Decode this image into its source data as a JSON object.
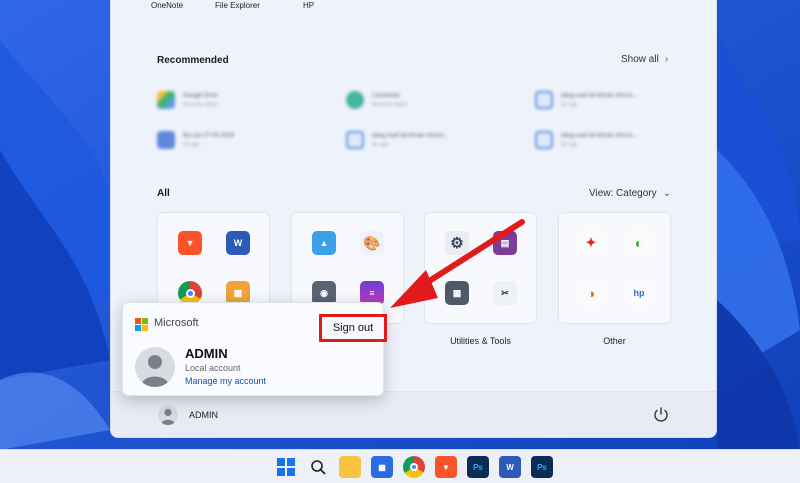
{
  "pinned": {
    "labels": [
      "OneNote",
      "File Explorer",
      "HP"
    ]
  },
  "recommended": {
    "title": "Recommended",
    "show_all": "Show all",
    "items": [
      {
        "name": "Google Drive",
        "detail": "Recently added",
        "color": "#3ba55c"
      },
      {
        "name": "Localsend",
        "detail": "Recently added",
        "color": "#1aa58e"
      },
      {
        "name": "dang xuat tai khoan micros...",
        "detail": "2m ago",
        "color": "#3a7be0"
      },
      {
        "name": "Ba can 27-04-2026",
        "detail": "5m ago",
        "color": "#3a6fd8"
      },
      {
        "name": "dang xuat tai khoan micros...",
        "detail": "4m ago",
        "color": "#3a7be0"
      },
      {
        "name": "dang xuat tai khoan micros...",
        "detail": "5m ago",
        "color": "#3a7be0"
      }
    ]
  },
  "all": {
    "title": "All",
    "view": "View: Category"
  },
  "folders": [
    {
      "label": ""
    },
    {
      "label": ""
    },
    {
      "label": "Utilities & Tools"
    },
    {
      "label": "Other"
    }
  ],
  "account_card": {
    "brand": "Microsoft",
    "sign_out": "Sign out",
    "name": "ADMIN",
    "type": "Local account",
    "manage": "Manage my account"
  },
  "user_bar": {
    "name": "ADMIN"
  },
  "colors": {
    "accent_red": "#e11b1b",
    "link_blue": "#1a4fa8"
  }
}
